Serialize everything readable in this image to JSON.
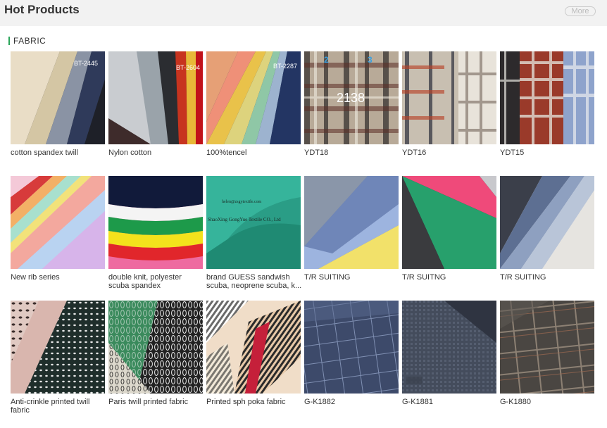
{
  "header": {
    "title": "Hot Products",
    "more_label": "More"
  },
  "category": {
    "label": "FABRIC"
  },
  "watermarks": {
    "p1": "BT-2445",
    "p2": "BT-2604",
    "p3": "BT-2287",
    "p4_num": "2138",
    "p4_tag1": "2",
    "p4_tag2": "3",
    "p9_line1": "helen@zsgytextile.com",
    "p9_line2": "ShaoXing GongYue Textile CO., Ltd"
  },
  "products": [
    {
      "label": "cotton spandex twill"
    },
    {
      "label": "Nylon cotton"
    },
    {
      "label": "100%tencel"
    },
    {
      "label": "YDT18"
    },
    {
      "label": "YDT16"
    },
    {
      "label": "YDT15"
    },
    {
      "label": "New rib series"
    },
    {
      "label": "double knit, polyester scuba spandex"
    },
    {
      "label": "brand GUESS sandwish scuba, neoprene scuba, k..."
    },
    {
      "label": "T/R SUITING"
    },
    {
      "label": "T/R SUITNG"
    },
    {
      "label": "T/R SUITING"
    },
    {
      "label": "Anti-crinkle printed twill fabric"
    },
    {
      "label": "Paris twill printed fabric"
    },
    {
      "label": "Printed sph poka fabric"
    },
    {
      "label": "G-K1882"
    },
    {
      "label": "G-K1881"
    },
    {
      "label": "G-K1880"
    }
  ]
}
